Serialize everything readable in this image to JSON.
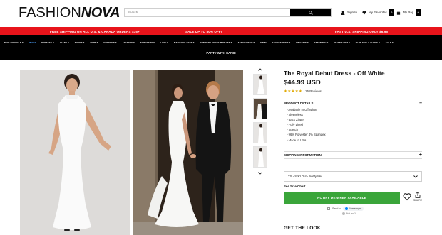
{
  "header": {
    "logo_part1": "FASHION",
    "logo_part2": "NOVA",
    "search_placeholder": "Search",
    "sign_in": "Sign In",
    "favorites": "My Favorites",
    "favorites_count": "0",
    "bag": "My Bag",
    "bag_count": "0"
  },
  "promo": {
    "left": "FREE SHIPPING ON ALL U.S. & CANADA ORDERS $75+",
    "center": "SALE UP TO 80% OFF!",
    "right": "FAST U.S. SHIPPING ONLY $6.95"
  },
  "nav": {
    "items": [
      "NEW ARRIVALS ▾",
      "MEN ▾",
      "DRESSES ▾",
      "JEANS ▾",
      "SHOES ▾",
      "TOPS ▾",
      "BOTTOMS ▾",
      "JACKETS ▾",
      "SWEATERS ▾",
      "LUXE ▾",
      "MATCHING SETS ▾",
      "ROMPERS AND JUMPSUITS ▾",
      "ACTIVEWEAR ▾",
      "SWIM",
      "ACCESSORIES ▾",
      "LINGERIE ▾",
      "ESSENTIALS",
      "WHAT'S HOT ▾",
      "PLUS SIZE & CURVE ▾",
      "SALE ▾"
    ],
    "active_index": 1,
    "row2": "PARTY WITH CARDI"
  },
  "product": {
    "title": "The Royal Debut Dress - Off White",
    "price": "$44.99 USD",
    "stars": "★★★★★",
    "reviews": "25 Reviews",
    "details_label": "PRODUCT DETAILS",
    "details_symbol": "–",
    "details": [
      "Available In Off White",
      "Sleeveless",
      "Back Zipper",
      "Fully Lined",
      "Stretch",
      "96% Polyester 4% Spandex",
      "Made In USA"
    ],
    "shipping_label": "SHIPPING INFORMATION",
    "shipping_symbol": "+",
    "size_select": "XS - Sold Out - Notify Me",
    "size_chart": "See Size Chart",
    "notify_button": "NOTIFY ME WHEN AVAILABLE",
    "share_label": "SHARE",
    "messenger_send": "Send to",
    "messenger_pill": "Messenger",
    "not_you": "Not you?",
    "get_the_look": "GET THE LOOK"
  },
  "colors": {
    "promo_bg": "#e8141b",
    "nav_bg": "#000000",
    "nav_active": "#4fa3ff",
    "notify_bg": "#3aa53a",
    "star": "#e0a800"
  }
}
